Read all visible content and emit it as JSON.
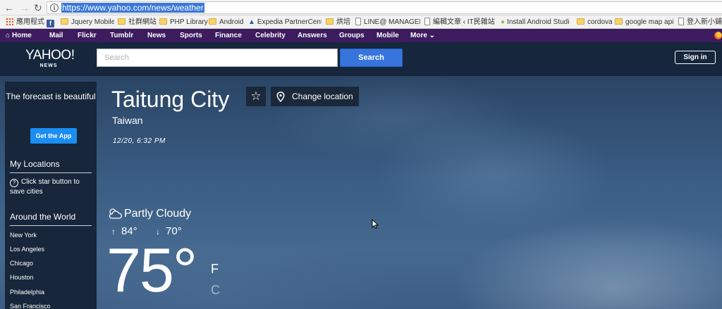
{
  "browser": {
    "url": "https://www.yahoo.com/news/weather",
    "bookmarks": [
      {
        "label": "應用程式",
        "icon": "apps-grid-icon"
      },
      {
        "label": "",
        "icon": "facebook-icon"
      },
      {
        "label": "Jquery Mobile",
        "icon": "folder-icon"
      },
      {
        "label": "社群網站",
        "icon": "folder-icon"
      },
      {
        "label": "PHP Library",
        "icon": "folder-icon"
      },
      {
        "label": "Android",
        "icon": "folder-icon"
      },
      {
        "label": "Expedia PartnerCent",
        "icon": "expedia-icon"
      },
      {
        "label": "烘培",
        "icon": "folder-icon"
      },
      {
        "label": "LINE@ MANAGER",
        "icon": "page-icon"
      },
      {
        "label": "編輯文章 ‹ IT民雜站 ›",
        "icon": "page-icon"
      },
      {
        "label": "Install Android Studi",
        "icon": "android-icon"
      },
      {
        "label": "cordova",
        "icon": "folder-icon"
      },
      {
        "label": "google map api",
        "icon": "folder-icon"
      },
      {
        "label": "登入新小鋪",
        "icon": "page-icon"
      }
    ]
  },
  "yahoo_nav": {
    "items": [
      "Home",
      "Mail",
      "Flickr",
      "Tumblr",
      "News",
      "Sports",
      "Finance",
      "Celebrity",
      "Answers",
      "Groups",
      "Mobile",
      "More ⌄"
    ]
  },
  "header": {
    "logo_main": "YAHOO!",
    "logo_sub": "NEWS",
    "search_placeholder": "Search",
    "search_button": "Search",
    "signin_button": "Sign in"
  },
  "sidebar": {
    "promo_text": "The forecast is beautiful",
    "get_app": "Get the App",
    "my_locations": "My Locations",
    "my_locations_note": "Click star button to save cities",
    "around_world": "Around the World",
    "cities": [
      "New York",
      "Los Angeles",
      "Chicago",
      "Houston",
      "Philadelphia",
      "San Francisco"
    ]
  },
  "weather": {
    "city": "Taitung City",
    "country": "Taiwan",
    "datetime": "12/20, 6:32 PM",
    "change_location": "Change location",
    "condition": "Partly Cloudy",
    "high": "84°",
    "low": "70°",
    "temperature": "75°",
    "unit_f": "F",
    "unit_c": "C"
  }
}
